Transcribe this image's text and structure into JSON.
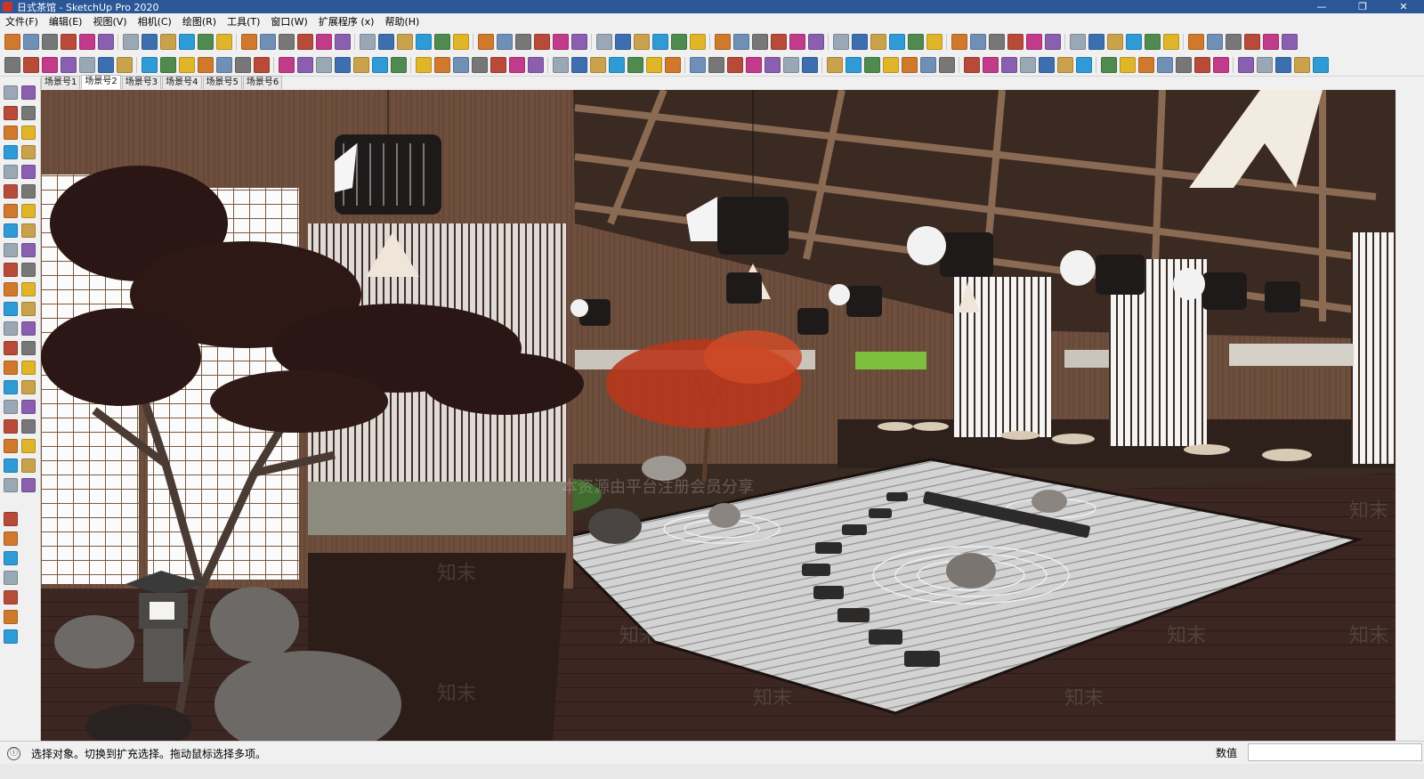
{
  "window": {
    "title": "日式茶馆 - SketchUp Pro 2020",
    "app_icon": "sketchup-icon",
    "controls": [
      "—",
      "❐",
      "✕"
    ]
  },
  "menu": [
    "文件(F)",
    "编辑(E)",
    "视图(V)",
    "相机(C)",
    "绘图(R)",
    "工具(T)",
    "窗口(W)",
    "扩展程序 (x)",
    "帮助(H)"
  ],
  "scenes": {
    "tabs": [
      "场景号1",
      "场景号2",
      "场景号3",
      "场景号4",
      "场景号5",
      "场景号6"
    ],
    "active_index": 1
  },
  "viewport": {
    "watermark_text": "知末",
    "caption_overlay": "本资源由平台注册会员分享"
  },
  "statusbar": {
    "info_icon": "ⓘ",
    "hint": "选择对象。切换到扩充选择。拖动鼠标选择多项。",
    "measurements_label": "数值",
    "measurements_value": ""
  },
  "colors": {
    "titlebar": "#2b5797",
    "chrome": "#f0f0f0",
    "wall_wood": "#6b4d3c",
    "floor_wood": "#3a2520",
    "gravel": "#c9c9c9",
    "maple_red": "#c23a1e"
  }
}
